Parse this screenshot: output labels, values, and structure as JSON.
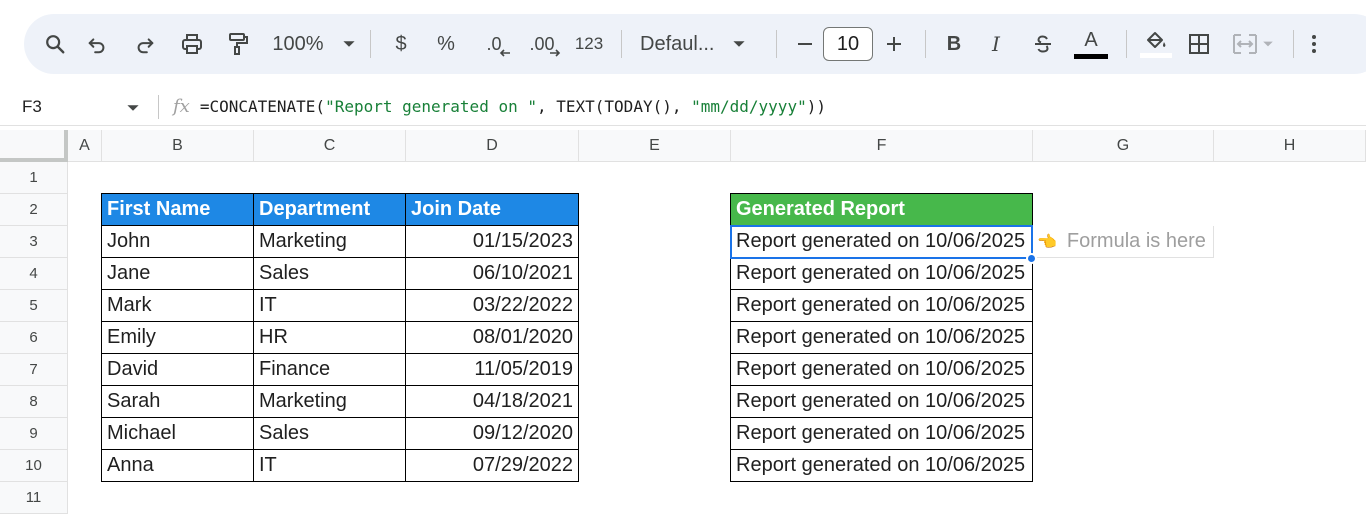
{
  "toolbar": {
    "zoom": "100%",
    "currency": "$",
    "percent": "%",
    "decimal_decrease": ".0",
    "decimal_increase": ".00",
    "number_format": "123",
    "font": "Defaul...",
    "font_size": "10",
    "bold": "B",
    "italic": "I",
    "text_color": "A"
  },
  "formula_bar": {
    "cell_ref": "F3",
    "fx": "fx",
    "formula_prefix": "=CONCATENATE(",
    "formula_str1": "\"Report generated on \"",
    "formula_mid": ", TEXT(TODAY(), ",
    "formula_str2": "\"mm/dd/yyyy\"",
    "formula_suffix": "))"
  },
  "columns": [
    "A",
    "B",
    "C",
    "D",
    "E",
    "F",
    "G",
    "H"
  ],
  "rows": [
    "1",
    "2",
    "3",
    "4",
    "5",
    "6",
    "7",
    "8",
    "9",
    "10",
    "11"
  ],
  "table": {
    "headers": [
      "First Name",
      "Department",
      "Join Date"
    ],
    "rows": [
      [
        "John",
        "Marketing",
        "01/15/2023"
      ],
      [
        "Jane",
        "Sales",
        "06/10/2021"
      ],
      [
        "Mark",
        "IT",
        "03/22/2022"
      ],
      [
        "Emily",
        "HR",
        "08/01/2020"
      ],
      [
        "David",
        "Finance",
        "11/05/2019"
      ],
      [
        "Sarah",
        "Marketing",
        "04/18/2021"
      ],
      [
        "Michael",
        "Sales",
        "09/12/2020"
      ],
      [
        "Anna",
        "IT",
        "07/29/2022"
      ]
    ]
  },
  "report": {
    "header": "Generated Report",
    "values": [
      "Report generated on 10/06/2025",
      "Report generated on 10/06/2025",
      "Report generated on 10/06/2025",
      "Report generated on 10/06/2025",
      "Report generated on 10/06/2025",
      "Report generated on 10/06/2025",
      "Report generated on 10/06/2025",
      "Report generated on 10/06/2025"
    ]
  },
  "annotation": {
    "pointer": "👈",
    "text": "Formula is here"
  },
  "colors": {
    "header_blue": "#1e88e5",
    "header_green": "#47b84b",
    "selection": "#1a73e8",
    "formula_string": "#188038"
  }
}
